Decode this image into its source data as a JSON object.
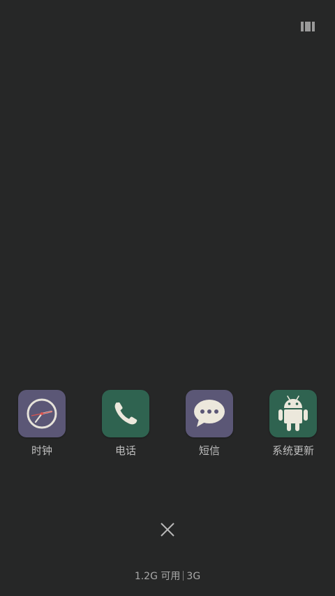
{
  "recents_menu": {
    "icon": "recents-list-icon"
  },
  "apps": [
    {
      "label": "时钟",
      "icon": "clock-icon",
      "color": "#5b5776"
    },
    {
      "label": "电话",
      "icon": "phone-icon",
      "color": "#2f6350"
    },
    {
      "label": "短信",
      "icon": "message-bubble-icon",
      "color": "#5b5776"
    },
    {
      "label": "系统更新",
      "icon": "android-icon",
      "color": "#2f6350"
    }
  ],
  "close_all": {
    "icon": "close-icon"
  },
  "memory": {
    "available": "1.2G 可用",
    "total": "3G"
  }
}
